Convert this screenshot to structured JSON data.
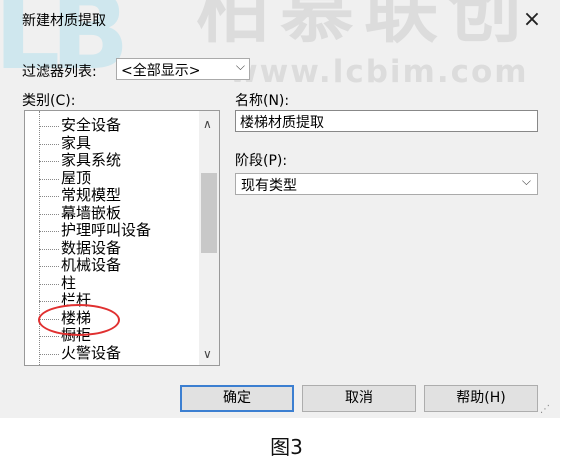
{
  "dialog": {
    "title": "新建材质提取",
    "close_symbol": "×"
  },
  "watermark": {
    "logo": "LB",
    "chinese": "柏慕联创",
    "url": "www.lcbim.com"
  },
  "filter": {
    "label": "过滤器列表:",
    "value": "<全部显示>"
  },
  "category": {
    "label": "类别(C):",
    "items": [
      "安全设备",
      "家具",
      "家具系统",
      "屋顶",
      "常规模型",
      "幕墙嵌板",
      "护理呼叫设备",
      "数据设备",
      "机械设备",
      "柱",
      "栏杆",
      "楼梯",
      "橱柜",
      "火警设备"
    ],
    "highlighted": "楼梯"
  },
  "name": {
    "label": "名称(N):",
    "value": "楼梯材质提取"
  },
  "phase": {
    "label": "阶段(P):",
    "value": "现有类型"
  },
  "buttons": {
    "ok": "确定",
    "cancel": "取消",
    "help": "帮助(H)"
  },
  "caption": "图3"
}
